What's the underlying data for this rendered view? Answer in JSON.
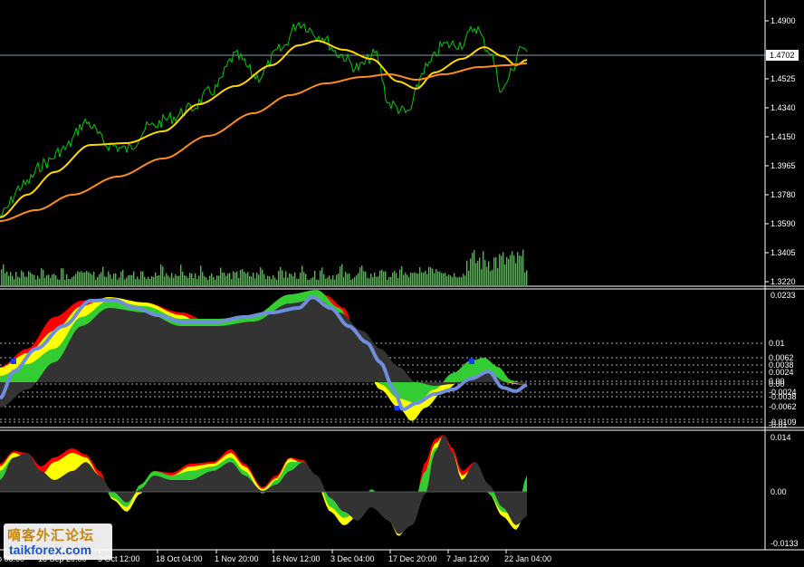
{
  "colors": {
    "background": "#000000",
    "axis": "#ffffff",
    "price_line": "#00cc00",
    "ma_fast": "#ffd700",
    "ma_slow": "#ff8c1a",
    "volume": "#33cc33",
    "blue_line": "#6f8fdc",
    "red": "#ff0000",
    "yellow": "#ffff00",
    "green": "#33cc33",
    "gray": "#333333",
    "current_price_label_bg": "#ffffff"
  },
  "main_panel": {
    "price_labels": [
      "1.4900",
      "1.4525",
      "1.4340",
      "1.4150",
      "1.3965",
      "1.3780",
      "1.3590",
      "1.3405",
      "1.3220"
    ],
    "current_price_label": "1.4702"
  },
  "indicator_panel_1": {
    "top_label": "0.0233",
    "levels": [
      "0.01",
      "0.0062",
      "0.0038",
      "0.0024",
      "0.00",
      "0.00",
      "-0.0024",
      "-0.0038",
      "-0.0062",
      "-0.0109",
      "-0.01"
    ]
  },
  "indicator_panel_2": {
    "labels": [
      "0.014",
      "0.00",
      "-0.0133"
    ]
  },
  "time_axis": {
    "labels": [
      "p 08:00",
      "18 Sep 20:00",
      "3 Oct 12:00",
      "18 Oct 04:00",
      "1 Nov 20:00",
      "16 Nov 12:00",
      "3 Dec 04:00",
      "17 Dec 20:00",
      "7 Jan 12:00",
      "22 Jan 04:00"
    ]
  },
  "watermark": {
    "chinese": "嘀客外汇论坛",
    "url": "taikforex.com"
  }
}
